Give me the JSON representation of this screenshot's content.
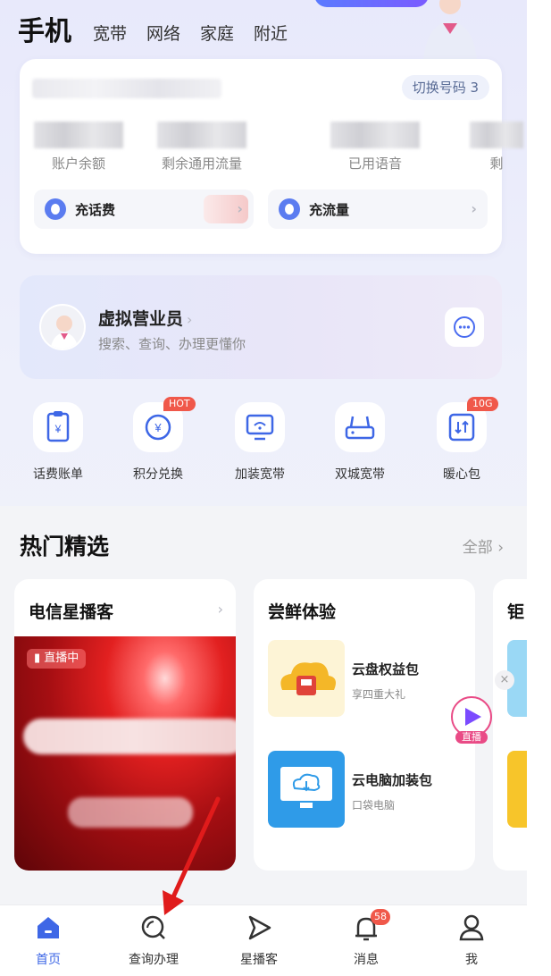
{
  "top_nav": {
    "primary": "手机",
    "tabs": [
      "宽带",
      "网络",
      "家庭",
      "附近"
    ]
  },
  "account": {
    "switch_number_label": "切换号码 3",
    "stats": [
      {
        "label": "账户余额"
      },
      {
        "label": "剩余通用流量"
      },
      {
        "label": "已用语音"
      },
      {
        "label": "剩"
      }
    ],
    "quick_actions": [
      {
        "label": "充话费"
      },
      {
        "label": "充流量"
      }
    ]
  },
  "virtual_agent": {
    "title": "虚拟营业员",
    "subtitle": "搜索、查询、办理更懂你"
  },
  "services": [
    {
      "label": "话费账单",
      "badge": ""
    },
    {
      "label": "积分兑换",
      "badge": "HOT"
    },
    {
      "label": "加装宽带",
      "badge": ""
    },
    {
      "label": "双城宽带",
      "badge": ""
    },
    {
      "label": "暖心包",
      "badge": "10G"
    }
  ],
  "hot_section": {
    "title": "热门精选",
    "more_label": "全部",
    "cards": [
      {
        "title": "电信星播客",
        "live_tag": "直播中"
      },
      {
        "title": "尝鲜体验",
        "products": [
          {
            "name": "云盘权益包",
            "sub": "享四重大礼"
          },
          {
            "name": "云电脑加装包",
            "sub": "口袋电脑"
          }
        ]
      },
      {
        "title": "钜"
      }
    ],
    "float_live_label": "直播"
  },
  "tabbar": {
    "items": [
      {
        "label": "首页",
        "active": true
      },
      {
        "label": "查询办理",
        "active": false
      },
      {
        "label": "星播客",
        "active": false
      },
      {
        "label": "消息",
        "active": false,
        "badge": "58"
      },
      {
        "label": "我",
        "active": false
      }
    ]
  },
  "colors": {
    "accent": "#3e67e6",
    "badge": "#f0584a",
    "live_red": "#d81a1f"
  }
}
